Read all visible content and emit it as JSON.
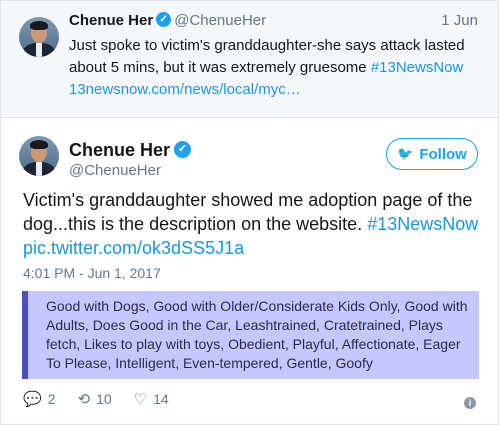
{
  "reply_tweet": {
    "name": "Chenue Her",
    "handle": "@ChenueHer",
    "date": "1 Jun",
    "text_main": "Just spoke to victim's granddaughter-she says attack lasted about 5 mins, but it was extremely gruesome ",
    "hashtag": "#13NewsNow",
    "link": "13newsnow.com/news/local/myc…"
  },
  "main_tweet": {
    "name": "Chenue Her",
    "handle": "@ChenueHer",
    "follow_label": "Follow",
    "text_main": "Victim's granddaughter showed me adoption page of the dog...this is the description on the website. ",
    "hashtag": "#13NewsNow",
    "link": "pic.twitter.com/ok3dSS5J1a",
    "timestamp": "4:01 PM - Jun 1, 2017",
    "quote_text": "Good with Dogs, Good with Older/Considerate Kids Only, Good with Adults, Does Good in the Car, Leashtrained, Cratetrained, Plays fetch, Likes to play with toys, Obedient, Playful, Affectionate, Eager To Please, Intelligent, Even-tempered, Gentle, Goofy",
    "actions": {
      "replies": "2",
      "retweets": "10",
      "likes": "14"
    }
  },
  "icons": {
    "verified": "verified-check-icon",
    "twitter_bird": "twitter-bird-icon",
    "reply": "reply-icon",
    "retweet": "retweet-icon",
    "like": "heart-icon",
    "info": "info-icon"
  },
  "colors": {
    "accent": "#1da1f2",
    "link": "#1b95e0",
    "muted": "#657786",
    "quote_bg": "#c4c8ff",
    "quote_bar": "#4b4dc4"
  }
}
